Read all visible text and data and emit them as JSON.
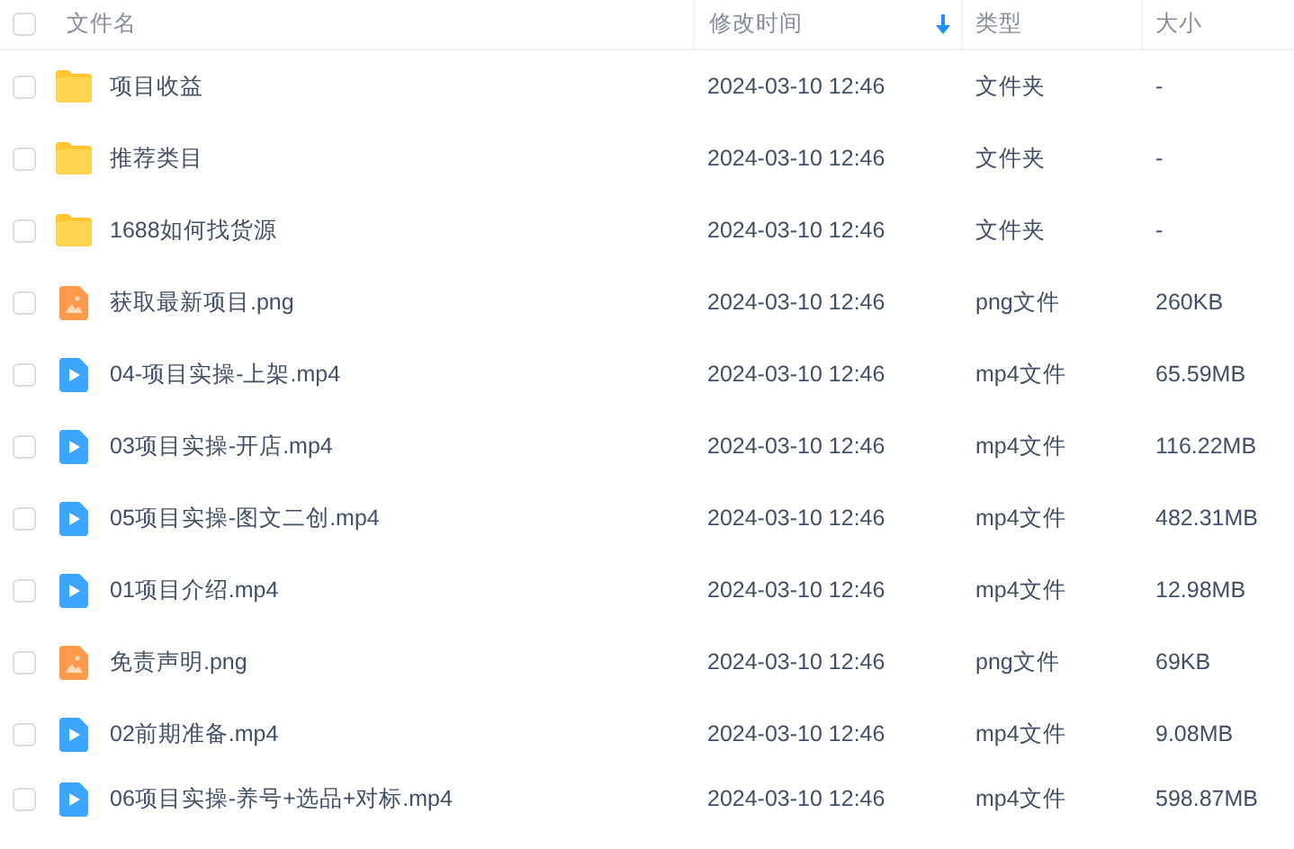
{
  "header": {
    "checked": false,
    "columns": [
      {
        "label": "文件名",
        "sorted": false
      },
      {
        "label": "修改时间",
        "sorted": true
      },
      {
        "label": "类型",
        "sorted": false
      },
      {
        "label": "大小",
        "sorted": false
      }
    ]
  },
  "rows": [
    {
      "kind": "folder",
      "checked": false,
      "name": "项目收益",
      "modified": "2024-03-10 12:46",
      "type": "文件夹",
      "size": "-"
    },
    {
      "kind": "folder",
      "checked": false,
      "name": "推荐类目",
      "modified": "2024-03-10 12:46",
      "type": "文件夹",
      "size": "-"
    },
    {
      "kind": "folder",
      "checked": false,
      "name": "1688如何找货源",
      "modified": "2024-03-10 12:46",
      "type": "文件夹",
      "size": "-"
    },
    {
      "kind": "image",
      "checked": false,
      "name": "获取最新项目.png",
      "modified": "2024-03-10 12:46",
      "type": "png文件",
      "size": "260KB"
    },
    {
      "kind": "video",
      "checked": false,
      "name": "04-项目实操-上架.mp4",
      "modified": "2024-03-10 12:46",
      "type": "mp4文件",
      "size": "65.59MB"
    },
    {
      "kind": "video",
      "checked": false,
      "name": "03项目实操-开店.mp4",
      "modified": "2024-03-10 12:46",
      "type": "mp4文件",
      "size": "116.22MB"
    },
    {
      "kind": "video",
      "checked": false,
      "name": "05项目实操-图文二创.mp4",
      "modified": "2024-03-10 12:46",
      "type": "mp4文件",
      "size": "482.31MB"
    },
    {
      "kind": "video",
      "checked": false,
      "name": "01项目介绍.mp4",
      "modified": "2024-03-10 12:46",
      "type": "mp4文件",
      "size": "12.98MB"
    },
    {
      "kind": "image",
      "checked": false,
      "name": "免责声明.png",
      "modified": "2024-03-10 12:46",
      "type": "png文件",
      "size": "69KB"
    },
    {
      "kind": "video",
      "checked": false,
      "name": "02前期准备.mp4",
      "modified": "2024-03-10 12:46",
      "type": "mp4文件",
      "size": "9.08MB"
    },
    {
      "kind": "video",
      "checked": false,
      "name": "06项目实操-养号+选品+对标.mp4",
      "modified": "2024-03-10 12:46",
      "type": "mp4文件",
      "size": "598.87MB"
    }
  ]
}
